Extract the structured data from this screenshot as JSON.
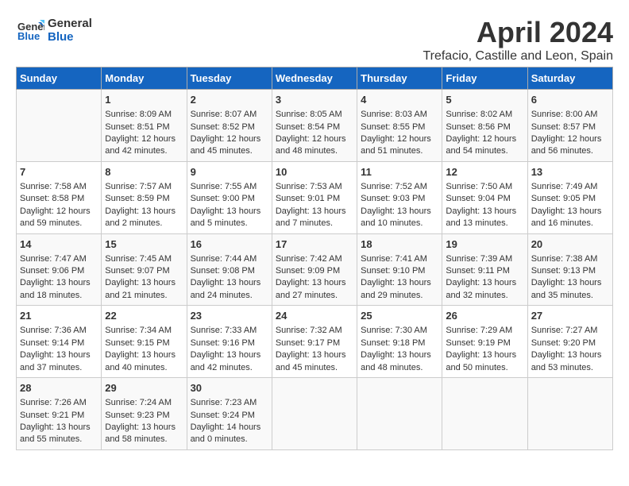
{
  "header": {
    "logo_line1": "General",
    "logo_line2": "Blue",
    "title": "April 2024",
    "subtitle": "Trefacio, Castille and Leon, Spain"
  },
  "calendar": {
    "days_of_week": [
      "Sunday",
      "Monday",
      "Tuesday",
      "Wednesday",
      "Thursday",
      "Friday",
      "Saturday"
    ],
    "weeks": [
      [
        {
          "day": "",
          "content": ""
        },
        {
          "day": "1",
          "content": "Sunrise: 8:09 AM\nSunset: 8:51 PM\nDaylight: 12 hours\nand 42 minutes."
        },
        {
          "day": "2",
          "content": "Sunrise: 8:07 AM\nSunset: 8:52 PM\nDaylight: 12 hours\nand 45 minutes."
        },
        {
          "day": "3",
          "content": "Sunrise: 8:05 AM\nSunset: 8:54 PM\nDaylight: 12 hours\nand 48 minutes."
        },
        {
          "day": "4",
          "content": "Sunrise: 8:03 AM\nSunset: 8:55 PM\nDaylight: 12 hours\nand 51 minutes."
        },
        {
          "day": "5",
          "content": "Sunrise: 8:02 AM\nSunset: 8:56 PM\nDaylight: 12 hours\nand 54 minutes."
        },
        {
          "day": "6",
          "content": "Sunrise: 8:00 AM\nSunset: 8:57 PM\nDaylight: 12 hours\nand 56 minutes."
        }
      ],
      [
        {
          "day": "7",
          "content": "Sunrise: 7:58 AM\nSunset: 8:58 PM\nDaylight: 12 hours\nand 59 minutes."
        },
        {
          "day": "8",
          "content": "Sunrise: 7:57 AM\nSunset: 8:59 PM\nDaylight: 13 hours\nand 2 minutes."
        },
        {
          "day": "9",
          "content": "Sunrise: 7:55 AM\nSunset: 9:00 PM\nDaylight: 13 hours\nand 5 minutes."
        },
        {
          "day": "10",
          "content": "Sunrise: 7:53 AM\nSunset: 9:01 PM\nDaylight: 13 hours\nand 7 minutes."
        },
        {
          "day": "11",
          "content": "Sunrise: 7:52 AM\nSunset: 9:03 PM\nDaylight: 13 hours\nand 10 minutes."
        },
        {
          "day": "12",
          "content": "Sunrise: 7:50 AM\nSunset: 9:04 PM\nDaylight: 13 hours\nand 13 minutes."
        },
        {
          "day": "13",
          "content": "Sunrise: 7:49 AM\nSunset: 9:05 PM\nDaylight: 13 hours\nand 16 minutes."
        }
      ],
      [
        {
          "day": "14",
          "content": "Sunrise: 7:47 AM\nSunset: 9:06 PM\nDaylight: 13 hours\nand 18 minutes."
        },
        {
          "day": "15",
          "content": "Sunrise: 7:45 AM\nSunset: 9:07 PM\nDaylight: 13 hours\nand 21 minutes."
        },
        {
          "day": "16",
          "content": "Sunrise: 7:44 AM\nSunset: 9:08 PM\nDaylight: 13 hours\nand 24 minutes."
        },
        {
          "day": "17",
          "content": "Sunrise: 7:42 AM\nSunset: 9:09 PM\nDaylight: 13 hours\nand 27 minutes."
        },
        {
          "day": "18",
          "content": "Sunrise: 7:41 AM\nSunset: 9:10 PM\nDaylight: 13 hours\nand 29 minutes."
        },
        {
          "day": "19",
          "content": "Sunrise: 7:39 AM\nSunset: 9:11 PM\nDaylight: 13 hours\nand 32 minutes."
        },
        {
          "day": "20",
          "content": "Sunrise: 7:38 AM\nSunset: 9:13 PM\nDaylight: 13 hours\nand 35 minutes."
        }
      ],
      [
        {
          "day": "21",
          "content": "Sunrise: 7:36 AM\nSunset: 9:14 PM\nDaylight: 13 hours\nand 37 minutes."
        },
        {
          "day": "22",
          "content": "Sunrise: 7:34 AM\nSunset: 9:15 PM\nDaylight: 13 hours\nand 40 minutes."
        },
        {
          "day": "23",
          "content": "Sunrise: 7:33 AM\nSunset: 9:16 PM\nDaylight: 13 hours\nand 42 minutes."
        },
        {
          "day": "24",
          "content": "Sunrise: 7:32 AM\nSunset: 9:17 PM\nDaylight: 13 hours\nand 45 minutes."
        },
        {
          "day": "25",
          "content": "Sunrise: 7:30 AM\nSunset: 9:18 PM\nDaylight: 13 hours\nand 48 minutes."
        },
        {
          "day": "26",
          "content": "Sunrise: 7:29 AM\nSunset: 9:19 PM\nDaylight: 13 hours\nand 50 minutes."
        },
        {
          "day": "27",
          "content": "Sunrise: 7:27 AM\nSunset: 9:20 PM\nDaylight: 13 hours\nand 53 minutes."
        }
      ],
      [
        {
          "day": "28",
          "content": "Sunrise: 7:26 AM\nSunset: 9:21 PM\nDaylight: 13 hours\nand 55 minutes."
        },
        {
          "day": "29",
          "content": "Sunrise: 7:24 AM\nSunset: 9:23 PM\nDaylight: 13 hours\nand 58 minutes."
        },
        {
          "day": "30",
          "content": "Sunrise: 7:23 AM\nSunset: 9:24 PM\nDaylight: 14 hours\nand 0 minutes."
        },
        {
          "day": "",
          "content": ""
        },
        {
          "day": "",
          "content": ""
        },
        {
          "day": "",
          "content": ""
        },
        {
          "day": "",
          "content": ""
        }
      ]
    ]
  }
}
